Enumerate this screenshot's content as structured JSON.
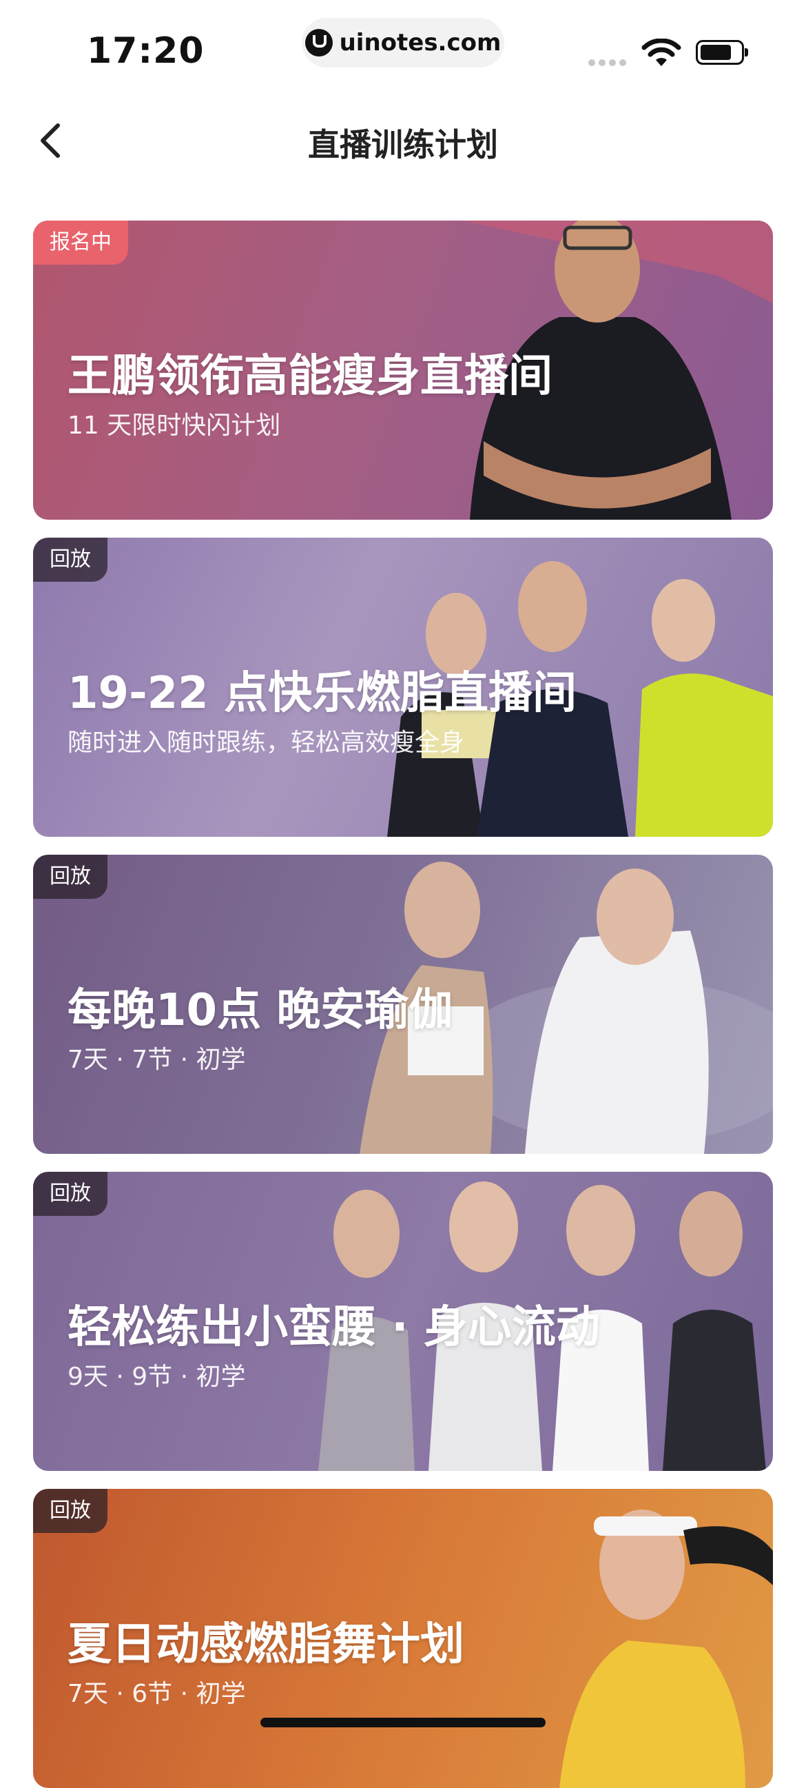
{
  "status_bar": {
    "time": "17:20",
    "url": "uinotes.com",
    "icons": [
      "signal-dots-icon",
      "wifi-icon",
      "battery-icon"
    ]
  },
  "nav": {
    "title": "直播训练计划",
    "back_icon": "chevron-left-icon"
  },
  "cards": [
    {
      "tag": "报名中",
      "title": "王鹏领衔高能瘦身直播间",
      "subtitle": "11 天限时快闪计划"
    },
    {
      "tag": "回放",
      "title": "19-22 点快乐燃脂直播间",
      "subtitle": "随时进入随时跟练，轻松高效瘦全身"
    },
    {
      "tag": "回放",
      "title": "每晚10点 晚安瑜伽",
      "subtitle": "7天 · 7节 · 初学"
    },
    {
      "tag": "回放",
      "title": "轻松练出小蛮腰 · 身心流动",
      "subtitle": "9天 · 9节 · 初学"
    },
    {
      "tag": "回放",
      "title": "夏日动感燃脂舞计划",
      "subtitle": "7天 · 6节 · 初学"
    }
  ],
  "colors": {
    "signup_tag": "#e9636c",
    "replay_tag": "#3a2d3a"
  }
}
